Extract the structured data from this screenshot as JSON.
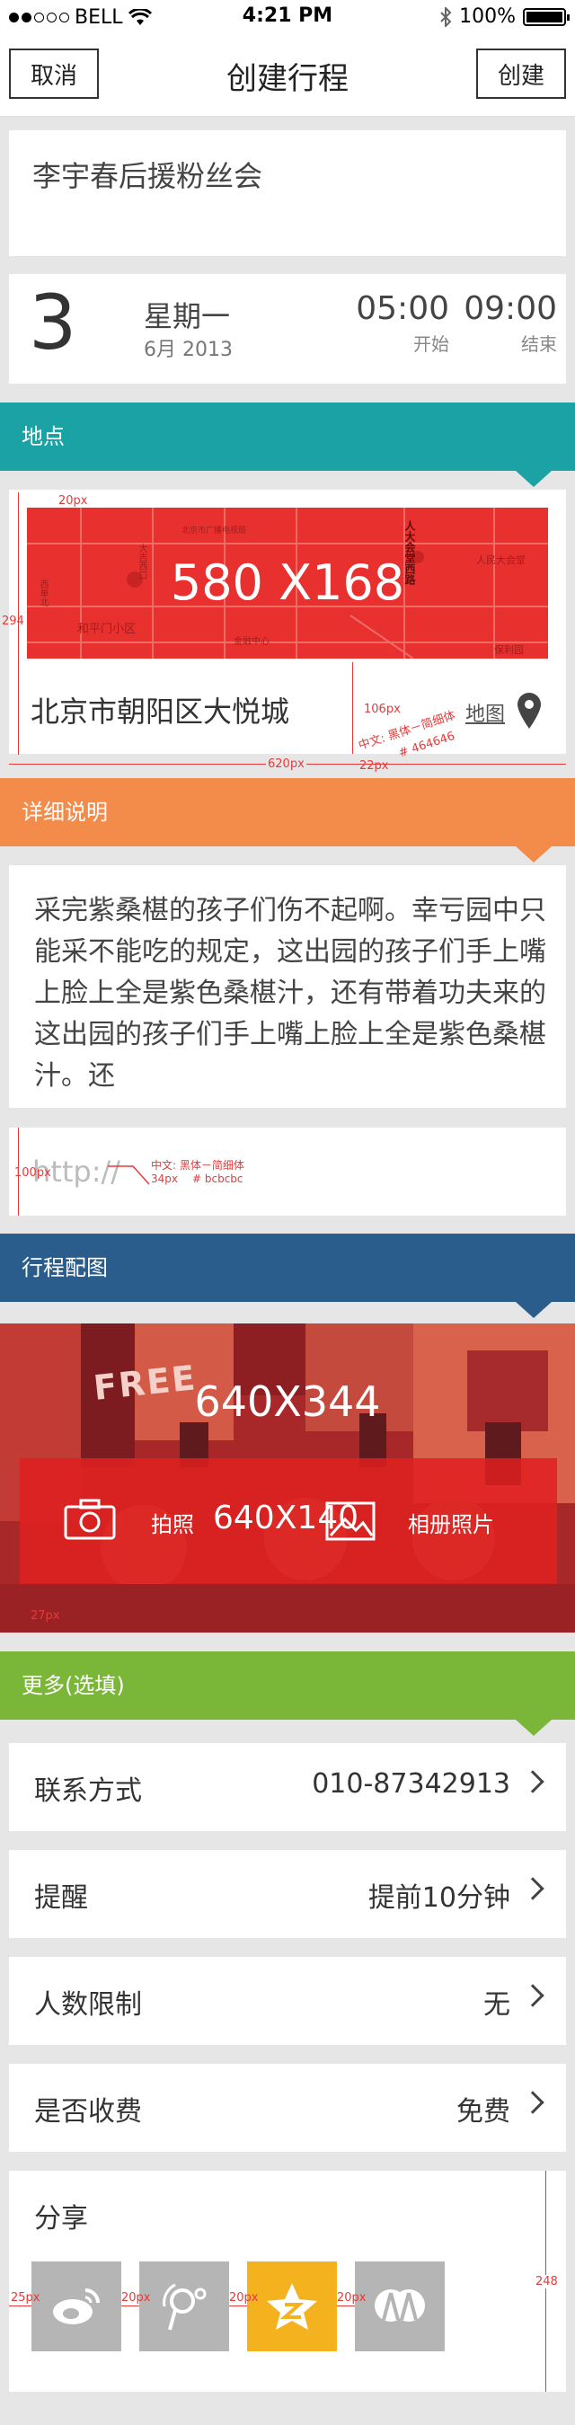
{
  "status_bar": {
    "carrier": "BELL",
    "time": "4:21 PM",
    "battery": "100%"
  },
  "nav": {
    "cancel": "取消",
    "title": "创建行程",
    "create": "创建"
  },
  "event": {
    "title": "李宇春后援粉丝会"
  },
  "date": {
    "day": "3",
    "weekday": "星期一",
    "month_year": "6月 2013",
    "start_time": "05:00",
    "start_label": "开始",
    "end_time": "09:00",
    "end_label": "结束"
  },
  "location": {
    "header": "地点",
    "address": "北京市朝阳区大悦城",
    "map_link": "地图",
    "map_placeholder": "580 X168",
    "map_labels": [
      "大吉西口",
      "金融中心",
      "和平门小区",
      "人大会堂西路",
      "人民大会堂",
      "西单北",
      "保利园",
      "北京市广播电视局"
    ]
  },
  "details": {
    "header": "详细说明",
    "text": "采完紫桑椹的孩子们伤不起啊。幸亏园中只能采不能吃的规定，这出园的孩子们手上嘴上脸上全是紫色桑椹汁，还有带着功夫来的这出园的孩子们手上嘴上脸上全是紫色桑椹汁。还",
    "url_placeholder": "http://"
  },
  "photo": {
    "header": "行程配图",
    "placeholder_main": "640X344",
    "take_photo": "拍照",
    "placeholder_bar": "640X140",
    "album": "相册照片",
    "sign_text": "FREE"
  },
  "more": {
    "header": "更多(选填)",
    "rows": [
      {
        "label": "联系方式",
        "value": "010-87342913"
      },
      {
        "label": "提醒",
        "value": "提前10分钟"
      },
      {
        "label": "人数限制",
        "value": "无"
      },
      {
        "label": "是否收费",
        "value": "免费"
      }
    ],
    "share_label": "分享",
    "share_icons": [
      "weibo-icon",
      "tencent-weibo-icon",
      "qzone-icon",
      "renren-icon"
    ]
  },
  "annotations": {
    "px20": "20px",
    "px294": "294",
    "px106": "106px",
    "px22": "22px",
    "px620": "620px",
    "font_note_1": "中文: 黑体－简细体",
    "color_note_1": "# 464646",
    "px100": "100px",
    "font_note_2": "中文: 黑体－简细体",
    "size_note_2": "34px",
    "color_note_2": "# bcbcbc",
    "px27": "27px",
    "px25": "25px",
    "px248": "248"
  },
  "colors": {
    "location": "#1aa2a4",
    "details": "#f38b4a",
    "photo": "#2a5d8c",
    "more": "#7ab638",
    "placeholder_red": "#e8312f",
    "qzone": "#f5b21f",
    "share_gray": "#b5b5b5"
  }
}
